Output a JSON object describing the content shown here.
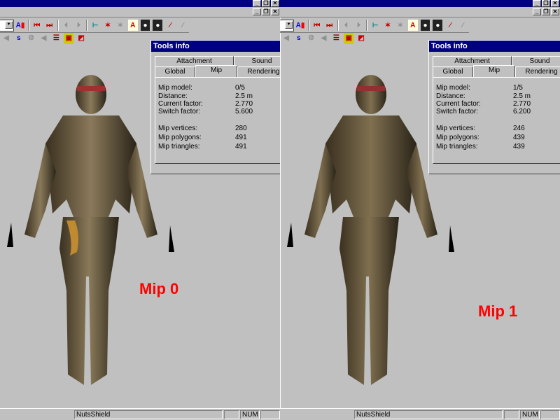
{
  "window_buttons": {
    "minimize": "_",
    "restore": "❐",
    "close": "✕"
  },
  "toolbar": {
    "row1_icons": [
      "combo-dropdown",
      "font-color-icon",
      "first-frame-icon",
      "last-frame-icon",
      "prev-frame-icon",
      "next-frame-icon",
      "axis-tool-icon",
      "add-light-icon",
      "remove-light-icon",
      "texture-icon",
      "sphere-add-icon",
      "sphere-remove-icon",
      "pin-add-icon",
      "pin-remove-icon"
    ],
    "row2_icons": [
      "shape-icon",
      "skeleton-icon",
      "gear-icon",
      "shape2-icon",
      "list-icon",
      "film-icon",
      "palette-icon"
    ]
  },
  "panes": [
    {
      "tools_window": {
        "title": "Tools info",
        "tabs_back": [
          "Attachment",
          "Sound"
        ],
        "tabs_front": [
          "Global",
          "Mip",
          "Rendering"
        ],
        "active_tab": "Mip",
        "rows": [
          {
            "label": "Mip model:",
            "value": "0/5"
          },
          {
            "label": "Distance:",
            "value": "2.5 m"
          },
          {
            "label": "Current factor:",
            "value": "2.770"
          },
          {
            "label": "Switch factor:",
            "value": "5.600"
          },
          {
            "label": "Mip vertices:",
            "value": "280"
          },
          {
            "label": "Mip polygons:",
            "value": "491"
          },
          {
            "label": "Mip triangles:",
            "value": "491"
          }
        ]
      },
      "viewport_label": "Mip 0",
      "status": {
        "model": "NutsShield",
        "num": "NUM"
      }
    },
    {
      "tools_window": {
        "title": "Tools info",
        "tabs_back": [
          "Attachment",
          "Sound"
        ],
        "tabs_front": [
          "Global",
          "Mip",
          "Rendering"
        ],
        "active_tab": "Mip",
        "rows": [
          {
            "label": "Mip model:",
            "value": "1/5"
          },
          {
            "label": "Distance:",
            "value": "2.5 m"
          },
          {
            "label": "Current factor:",
            "value": "2.770"
          },
          {
            "label": "Switch factor:",
            "value": "6.200"
          },
          {
            "label": "Mip vertices:",
            "value": "246"
          },
          {
            "label": "Mip polygons:",
            "value": "439"
          },
          {
            "label": "Mip triangles:",
            "value": "439"
          }
        ]
      },
      "viewport_label": "Mip 1",
      "status": {
        "model": "NutsShield",
        "num": "NUM"
      }
    }
  ]
}
